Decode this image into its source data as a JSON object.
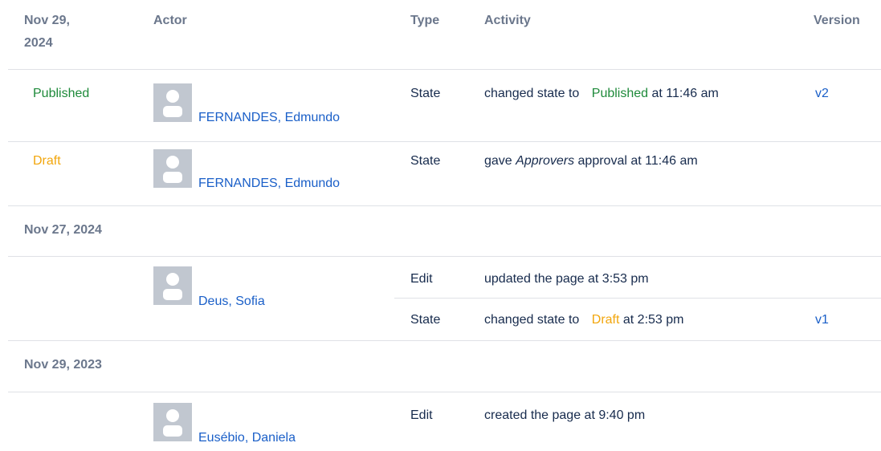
{
  "header": {
    "date_line1": "Nov 29,",
    "date_line2": "2024",
    "actor": "Actor",
    "type": "Type",
    "activity": "Activity",
    "version": "Version"
  },
  "groups": [
    {
      "date": "Nov 29, 2024",
      "entries": [
        {
          "state": "Published",
          "actor": "FERNANDES, Edmundo",
          "type": "State",
          "activity_prefix": "changed state to",
          "activity_state": "Published",
          "activity_suffix": "at 11:46 am",
          "version": "v2"
        },
        {
          "state": "Draft",
          "actor": "FERNANDES, Edmundo",
          "type": "State",
          "activity_prefix": "gave",
          "activity_em": "Approvers",
          "activity_suffix": "approval at 11:46 am",
          "version": ""
        }
      ]
    },
    {
      "date": "Nov 27, 2024",
      "entries": [
        {
          "actor": "Deus, Sofia",
          "sub": [
            {
              "type": "Edit",
              "activity": "updated the page at 3:53 pm"
            },
            {
              "type": "State",
              "activity_prefix": "changed state to",
              "activity_state": "Draft",
              "activity_suffix": "at 2:53 pm",
              "version": "v1"
            }
          ]
        }
      ]
    },
    {
      "date": "Nov 29, 2023",
      "entries": [
        {
          "actor": "Eusébio, Daniela",
          "sub": [
            {
              "type": "Edit",
              "activity": "created the page at 9:40 pm"
            }
          ]
        }
      ]
    }
  ],
  "colors": {
    "published": "#1e8a3a",
    "draft": "#f2a60c",
    "link": "#1a5fc8",
    "muted": "#6b778c",
    "divider": "#dfe1e6"
  }
}
